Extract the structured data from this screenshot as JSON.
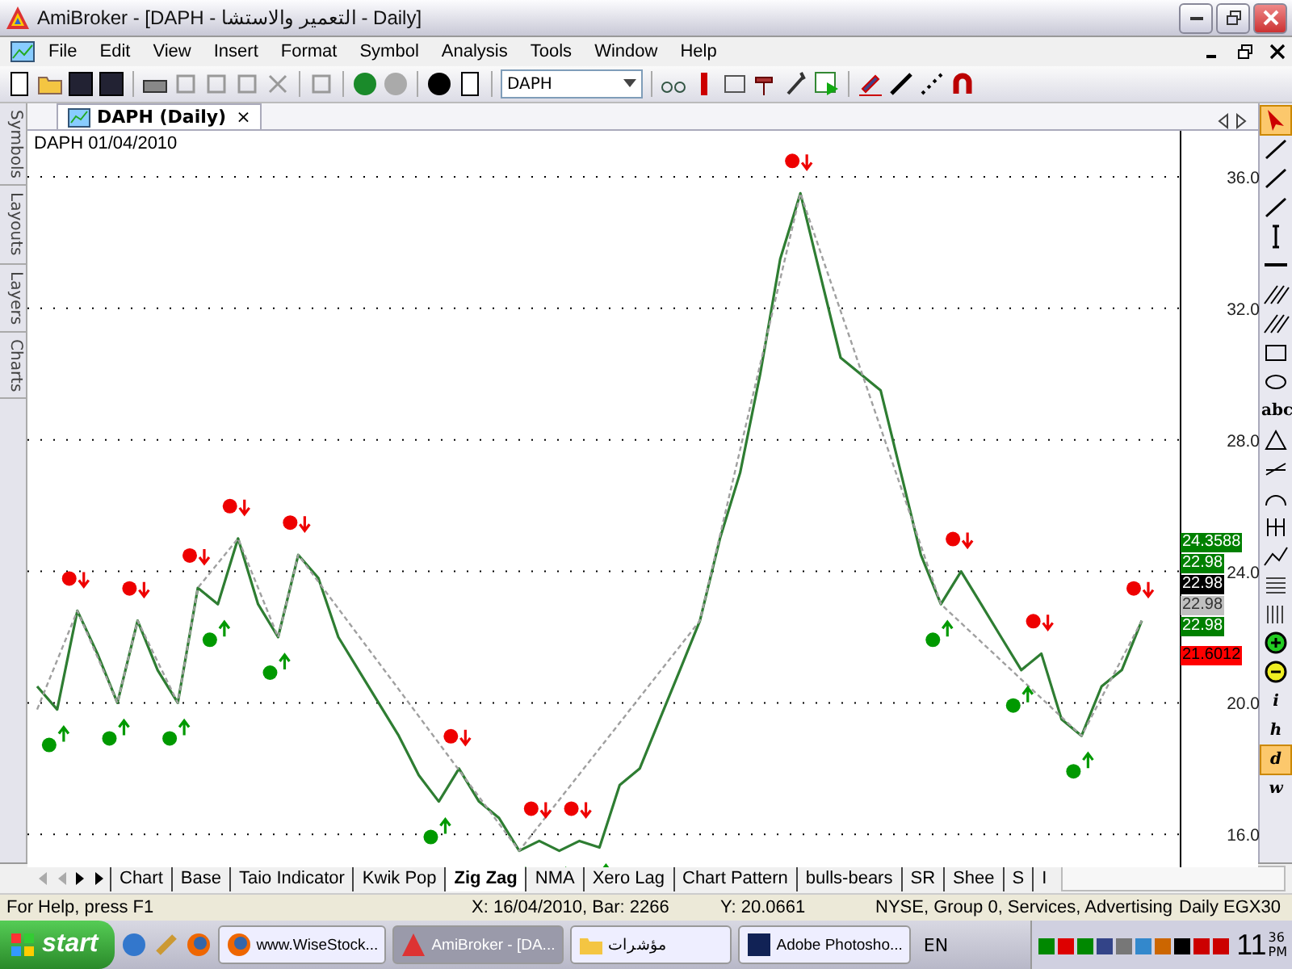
{
  "window": {
    "title": "AmiBroker - [DAPH - التعمير والاستشا - Daily]"
  },
  "menu": [
    "File",
    "Edit",
    "View",
    "Insert",
    "Format",
    "Symbol",
    "Analysis",
    "Tools",
    "Window",
    "Help"
  ],
  "toolbar": {
    "symbol": "DAPH"
  },
  "side_tabs": [
    {
      "label": "Symbols"
    },
    {
      "label": "Layouts"
    },
    {
      "label": "Layers"
    },
    {
      "label": "Charts"
    }
  ],
  "document_tab": {
    "label": "DAPH (Daily)",
    "close": "×"
  },
  "chart": {
    "caption": "DAPH 01/04/2010",
    "price_labels": [
      {
        "text": "24.3588",
        "color": "#008000"
      },
      {
        "text": "22.98",
        "color": "#008000"
      },
      {
        "text": "22.98",
        "color": "#000000"
      },
      {
        "text": "22.98",
        "color": "#c0c0c0"
      },
      {
        "text": "22.98",
        "color": "#008000"
      },
      {
        "text": "21.6012",
        "color": "#ff0000"
      }
    ],
    "chart_data": {
      "type": "line",
      "ylim": [
        15.0,
        37.4
      ],
      "grid": true,
      "yticks": [
        {
          "value": 16,
          "label": "16.0"
        },
        {
          "value": 20,
          "label": "20.0"
        },
        {
          "value": 24,
          "label": "24.0"
        },
        {
          "value": 28,
          "label": "28.0"
        },
        {
          "value": 32,
          "label": "32.0"
        },
        {
          "value": 36,
          "label": "36.0"
        }
      ],
      "series": [
        {
          "color": "#2e7d32",
          "line_style": "solid",
          "values": [
            20.5,
            19.8,
            22.8,
            21.5,
            20.0,
            22.5,
            21.0,
            20.0,
            23.5,
            23.0,
            25.0,
            23.0,
            22.0,
            24.5,
            23.8,
            22.0,
            21.0,
            20.0,
            19.0,
            17.8,
            17.0,
            18.0,
            17.0,
            16.5,
            15.5,
            15.8,
            15.5,
            15.8,
            15.6,
            17.5,
            18.0,
            19.5,
            21.0,
            22.5,
            25.0,
            27.0,
            30.0,
            33.5,
            35.5,
            33.0,
            30.5,
            30.0,
            29.5,
            27.0,
            24.5,
            23.0,
            24.0,
            23.0,
            22.0,
            21.0,
            21.5,
            19.5,
            19.0,
            20.5,
            21.0,
            22.5
          ]
        },
        {
          "color": "#a0a0a0",
          "line_style": "dashed",
          "values": [
            19.8,
            null,
            22.8,
            null,
            20.0,
            22.5,
            null,
            20.0,
            23.5,
            null,
            25.0,
            null,
            22.0,
            24.5,
            null,
            null,
            null,
            null,
            null,
            null,
            null,
            null,
            null,
            null,
            15.5,
            null,
            null,
            null,
            null,
            null,
            null,
            null,
            null,
            22.5,
            null,
            null,
            null,
            null,
            35.5,
            null,
            null,
            null,
            null,
            null,
            null,
            23.0,
            null,
            null,
            null,
            null,
            null,
            null,
            19.0,
            null,
            null,
            22.5
          ]
        }
      ]
    }
  },
  "drawing_tools": [
    {
      "kind": "pointer",
      "selected": true
    },
    {
      "kind": "segment",
      "selected": false
    },
    {
      "kind": "ray",
      "selected": false
    },
    {
      "kind": "extended",
      "selected": false
    },
    {
      "kind": "vertical",
      "selected": false
    },
    {
      "kind": "horizontal",
      "selected": false
    },
    {
      "kind": "parallel",
      "selected": false
    },
    {
      "kind": "fan",
      "selected": false
    },
    {
      "kind": "rectangle",
      "selected": false
    },
    {
      "kind": "ellipse",
      "selected": false
    },
    {
      "kind": "text",
      "label": "abc",
      "selected": false
    },
    {
      "kind": "triangle",
      "selected": false
    },
    {
      "kind": "fibonacci",
      "selected": false
    },
    {
      "kind": "arc",
      "selected": false
    },
    {
      "kind": "cycles",
      "selected": false
    },
    {
      "kind": "zigzag",
      "selected": false
    },
    {
      "kind": "hlines",
      "selected": false
    },
    {
      "kind": "vlines",
      "selected": false
    },
    {
      "kind": "zoom-in",
      "selected": false
    },
    {
      "kind": "zoom-out",
      "selected": false
    },
    {
      "kind": "interval",
      "label": "i",
      "selected": false
    },
    {
      "kind": "interval",
      "label": "h",
      "selected": false
    },
    {
      "kind": "interval",
      "label": "d",
      "selected": true
    },
    {
      "kind": "interval",
      "label": "w",
      "selected": false
    }
  ],
  "sheet_tabs": [
    {
      "label": "Chart",
      "selected": false
    },
    {
      "label": "Base",
      "selected": false
    },
    {
      "label": "Taio Indicator",
      "selected": false
    },
    {
      "label": "Kwik Pop",
      "selected": false
    },
    {
      "label": "Zig Zag",
      "selected": true
    },
    {
      "label": "NMA",
      "selected": false
    },
    {
      "label": "Xero Lag",
      "selected": false
    },
    {
      "label": "Chart Pattern",
      "selected": false
    },
    {
      "label": "bulls-bears",
      "selected": false
    },
    {
      "label": "SR",
      "selected": false
    },
    {
      "label": "Shee",
      "selected": false
    },
    {
      "label": "S",
      "selected": false
    },
    {
      "label": "I",
      "selected": false
    }
  ],
  "status_bar": [
    "For Help, press F1",
    "X: 16/04/2010, Bar: 2266",
    "Y: 20.0661",
    "NYSE, Group 0, Services, Advertising",
    "Daily EGX30"
  ],
  "taskbar": {
    "start": "start",
    "tasks": [
      {
        "label": "www.WiseStock...",
        "kind": "browser",
        "selected": false
      },
      {
        "label": "AmiBroker - [DA...",
        "kind": "amibroker",
        "selected": true
      },
      {
        "label": "مؤشرات",
        "kind": "folder",
        "selected": false
      },
      {
        "label": "Adobe Photosho...",
        "kind": "photoshop",
        "selected": false
      }
    ],
    "language": "EN",
    "clock": {
      "hour": "11",
      "minute": "36",
      "ampm": "PM"
    }
  }
}
